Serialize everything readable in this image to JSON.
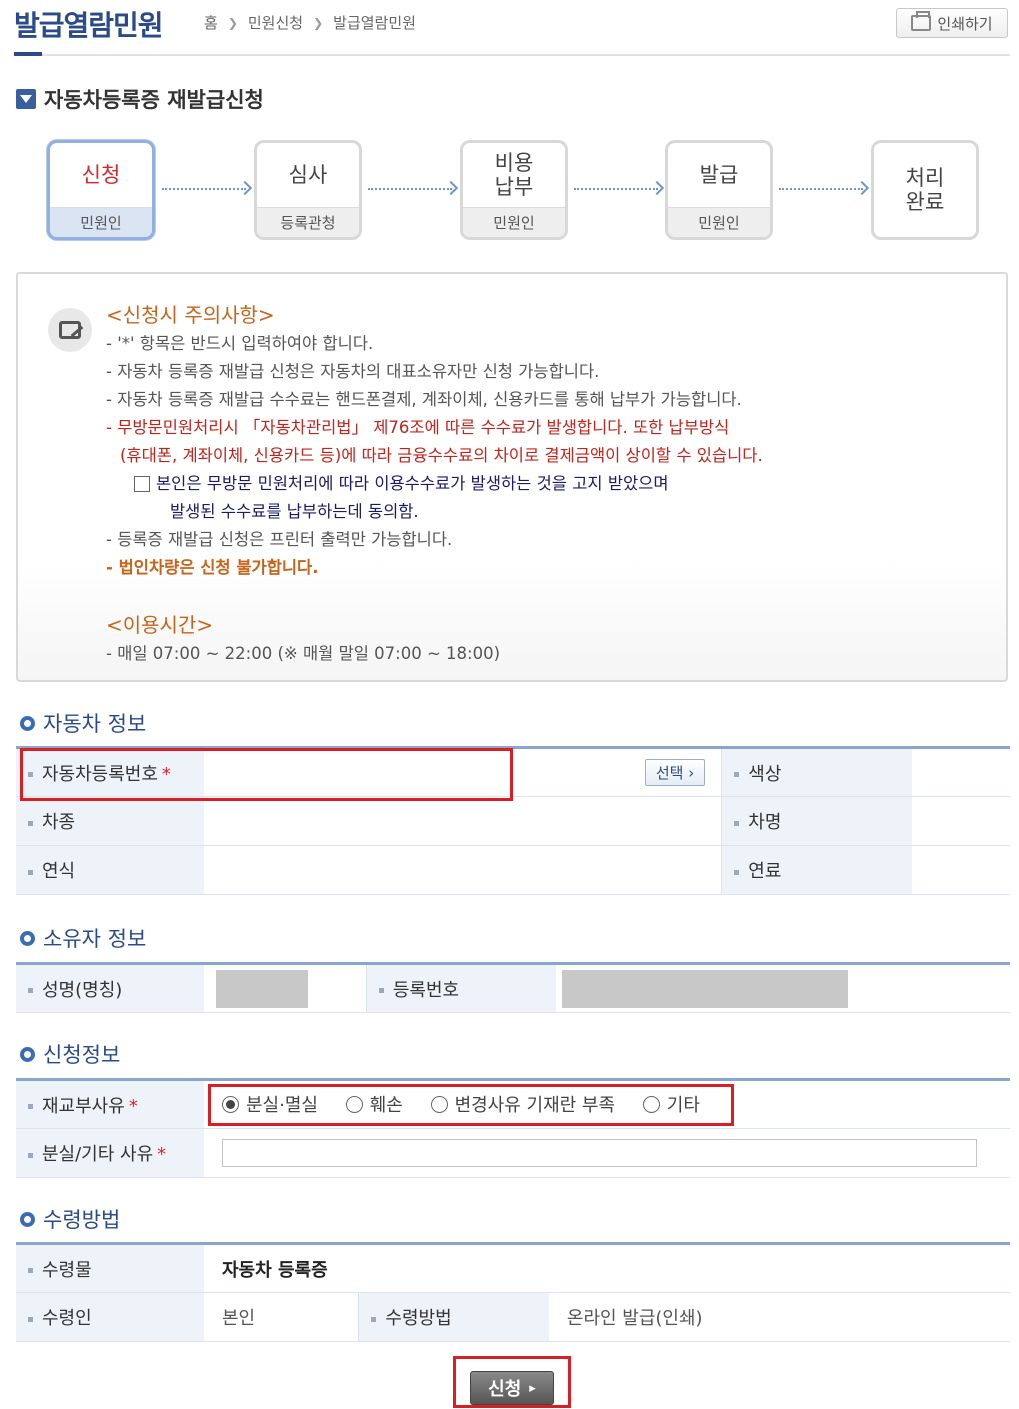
{
  "header": {
    "title": "발급열람민원",
    "breadcrumb": [
      "홈",
      "민원신청",
      "발급열람민원"
    ],
    "print_label": "인쇄하기"
  },
  "section_title": "자동차등록증 재발급신청",
  "steps": [
    {
      "label": "신청",
      "sub": "민원인",
      "active": true
    },
    {
      "label": "심사",
      "sub": "등록관청",
      "active": false
    },
    {
      "label": "비용\n납부",
      "sub": "민원인",
      "active": false
    },
    {
      "label": "발급",
      "sub": "민원인",
      "active": false
    },
    {
      "label": "처리\n완료",
      "sub": "",
      "active": false
    }
  ],
  "notice": {
    "heading1": "<신청시 주의사항>",
    "line1": "- '*' 항목은 반드시 입력하여야 합니다.",
    "line2": "- 자동차 등록증 재발급 신청은 자동차의 대표소유자만 신청 가능합니다.",
    "line3": "- 자동차 등록증 재발급 수수료는 핸드폰결제, 계좌이체, 신용카드를 통해 납부가 가능합니다.",
    "line4": "- 무방문민원처리시 「자동차관리법」 제76조에 따른 수수료가 발생합니다. 또한 납부방식",
    "line5": "(휴대폰, 계좌이체, 신용카드 등)에 따라 금융수수료의 차이로 결제금액이 상이할 수 있습니다.",
    "agree1": "본인은 무방문 민원처리에 따라 이용수수료가 발생하는 것을 고지 받았으며",
    "agree2": "발생된 수수료를 납부하는데 동의함.",
    "line6": "- 등록증 재발급 신청은 프린터 출력만 가능합니다.",
    "line7": "- 법인차량은 신청 불가합니다.",
    "heading2": "<이용시간>",
    "line8": "- 매일 07:00 ~ 22:00 (※ 매월 말일 07:00 ~ 18:00)"
  },
  "vehicle": {
    "title": "자동차 정보",
    "reg_no_label": "자동차등록번호",
    "select_label": "선택",
    "color_label": "색상",
    "type_label": "차종",
    "name_label": "차명",
    "year_label": "연식",
    "fuel_label": "연료"
  },
  "owner": {
    "title": "소유자 정보",
    "name_label": "성명(명칭)",
    "regno_label": "등록번호"
  },
  "application": {
    "title": "신청정보",
    "reason_label": "재교부사유",
    "reasons": [
      "분실·멸실",
      "훼손",
      "변경사유 기재란 부족",
      "기타"
    ],
    "selected_reason": 0,
    "other_label": "분실/기타 사유"
  },
  "receipt": {
    "title": "수령방법",
    "item_label": "수령물",
    "item_value": "자동차 등록증",
    "receiver_label": "수령인",
    "receiver_value": "본인",
    "method_label": "수령방법",
    "method_value": "온라인 발급(인쇄)"
  },
  "submit_label": "신청",
  "required_mark": "*"
}
